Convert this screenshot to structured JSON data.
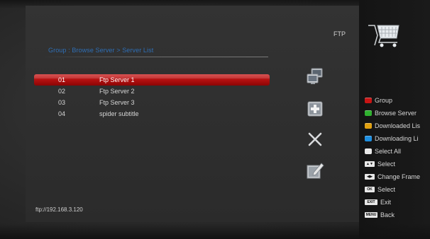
{
  "header": {
    "section_title": "FTP"
  },
  "breadcrumb": "Group : Browse Server > Server List",
  "server_list": [
    {
      "num": "01",
      "name": "Ftp Server 1",
      "selected": true
    },
    {
      "num": "02",
      "name": "Ftp Server 2",
      "selected": false
    },
    {
      "num": "03",
      "name": "Ftp Server 3",
      "selected": false
    },
    {
      "num": "04",
      "name": "spider subtitle",
      "selected": false
    }
  ],
  "status": {
    "url": "ftp://192.168.3.120"
  },
  "actions": [
    {
      "icon": "copy-windows-icon"
    },
    {
      "icon": "add-plus-icon"
    },
    {
      "icon": "delete-x-icon"
    },
    {
      "icon": "edit-pencil-icon"
    }
  ],
  "legend": {
    "group": {
      "label": "Group",
      "color": "#c81414"
    },
    "browse_server": {
      "label": "Browse Server",
      "color": "#2fb12f"
    },
    "downloaded": {
      "label": "Downloaded Lis",
      "color": "#e0a010"
    },
    "downloading": {
      "label": "Downloading Li",
      "color": "#1e8fe0"
    },
    "select_all": {
      "label": "Select All",
      "color": "#e8e8e8"
    },
    "select_updown": {
      "label": "Select",
      "key": "▲▼"
    },
    "change_frame": {
      "label": "Change Frame",
      "key": "◀▶"
    },
    "select_ok": {
      "label": "Select",
      "key": "OK"
    },
    "exit": {
      "label": "Exit",
      "key": "EXIT"
    },
    "back": {
      "label": "Back",
      "key": "MENU"
    }
  }
}
